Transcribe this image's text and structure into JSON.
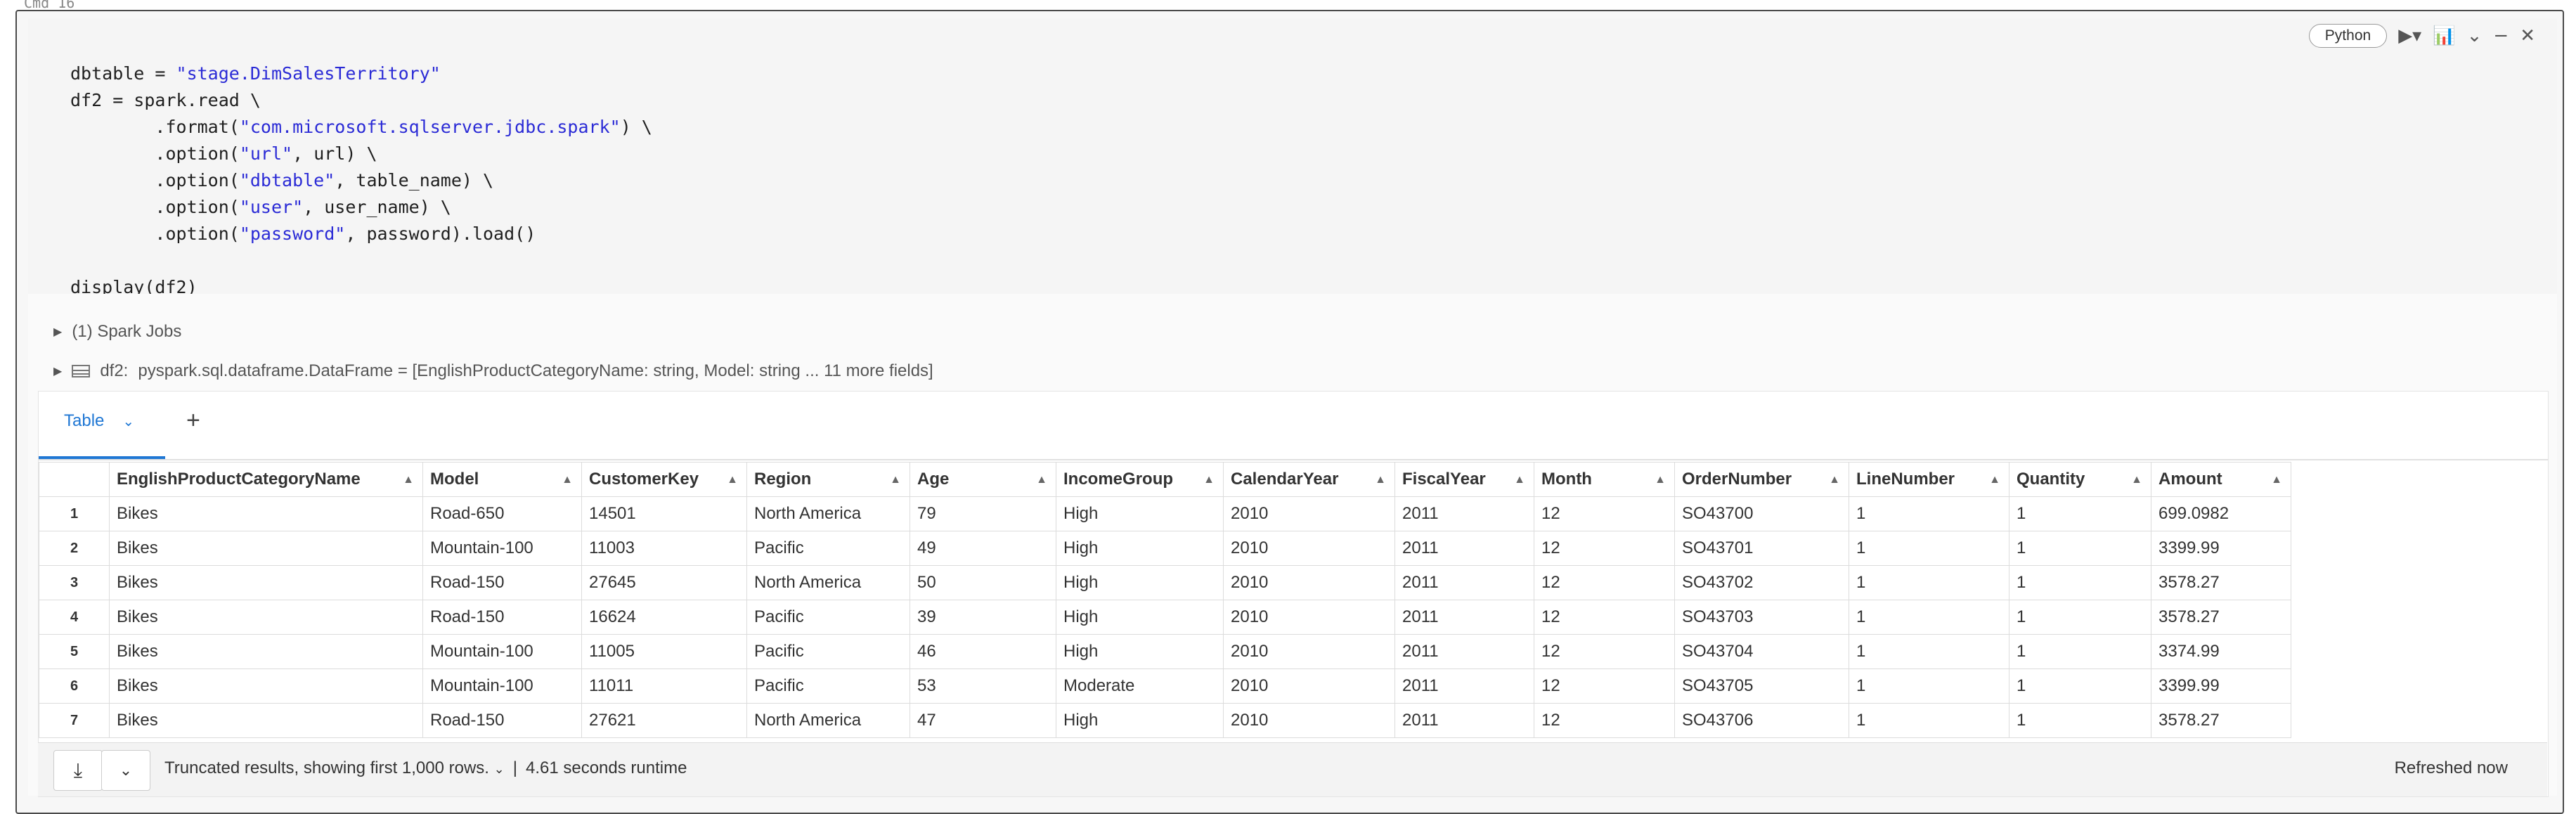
{
  "cell": {
    "cmd_label": "Cmd 16",
    "language": "Python",
    "code_lines": [
      [
        {
          "t": "dbtable = "
        },
        {
          "s": "\"stage.DimSalesTerritory\""
        }
      ],
      [
        {
          "t": "df2 = spark.read \\"
        }
      ],
      [
        {
          "t": "        .format("
        },
        {
          "s": "\"com.microsoft.sqlserver.jdbc.spark\""
        },
        {
          "t": ") \\"
        }
      ],
      [
        {
          "t": "        .option("
        },
        {
          "s": "\"url\""
        },
        {
          "t": ", url) \\"
        }
      ],
      [
        {
          "t": "        .option("
        },
        {
          "s": "\"dbtable\""
        },
        {
          "t": ", table_name) \\"
        }
      ],
      [
        {
          "t": "        .option("
        },
        {
          "s": "\"user\""
        },
        {
          "t": ", user_name) \\"
        }
      ],
      [
        {
          "t": "        .option("
        },
        {
          "s": "\"password\""
        },
        {
          "t": ", password).load()"
        }
      ],
      [
        {
          "t": ""
        }
      ],
      [
        {
          "t": "display(df2)"
        }
      ]
    ]
  },
  "output": {
    "spark_jobs": "(1) Spark Jobs",
    "df_name": "df2:",
    "df_schema": "pyspark.sql.dataframe.DataFrame = [EnglishProductCategoryName: string, Model: string ... 11 more fields]",
    "tab_label": "Table",
    "table": {
      "columns": [
        "EnglishProductCategoryName",
        "Model",
        "CustomerKey",
        "Region",
        "Age",
        "IncomeGroup",
        "CalendarYear",
        "FiscalYear",
        "Month",
        "OrderNumber",
        "LineNumber",
        "Quantity",
        "Amount"
      ],
      "rows": [
        [
          "1",
          "Bikes",
          "Road-650",
          "14501",
          "North America",
          "79",
          "High",
          "2010",
          "2011",
          "12",
          "SO43700",
          "1",
          "1",
          "699.0982"
        ],
        [
          "2",
          "Bikes",
          "Mountain-100",
          "11003",
          "Pacific",
          "49",
          "High",
          "2010",
          "2011",
          "12",
          "SO43701",
          "1",
          "1",
          "3399.99"
        ],
        [
          "3",
          "Bikes",
          "Road-150",
          "27645",
          "North America",
          "50",
          "High",
          "2010",
          "2011",
          "12",
          "SO43702",
          "1",
          "1",
          "3578.27"
        ],
        [
          "4",
          "Bikes",
          "Road-150",
          "16624",
          "Pacific",
          "39",
          "High",
          "2010",
          "2011",
          "12",
          "SO43703",
          "1",
          "1",
          "3578.27"
        ],
        [
          "5",
          "Bikes",
          "Mountain-100",
          "11005",
          "Pacific",
          "46",
          "High",
          "2010",
          "2011",
          "12",
          "SO43704",
          "1",
          "1",
          "3374.99"
        ],
        [
          "6",
          "Bikes",
          "Mountain-100",
          "11011",
          "Pacific",
          "53",
          "Moderate",
          "2010",
          "2011",
          "12",
          "SO43705",
          "1",
          "1",
          "3399.99"
        ],
        [
          "7",
          "Bikes",
          "Road-150",
          "27621",
          "North America",
          "47",
          "High",
          "2010",
          "2011",
          "12",
          "SO43706",
          "1",
          "1",
          "3578.27"
        ]
      ]
    },
    "footer": {
      "truncated": "Truncated results, showing first 1,000 rows.",
      "separator": "|",
      "runtime": "4.61 seconds runtime",
      "refreshed": "Refreshed now"
    }
  }
}
